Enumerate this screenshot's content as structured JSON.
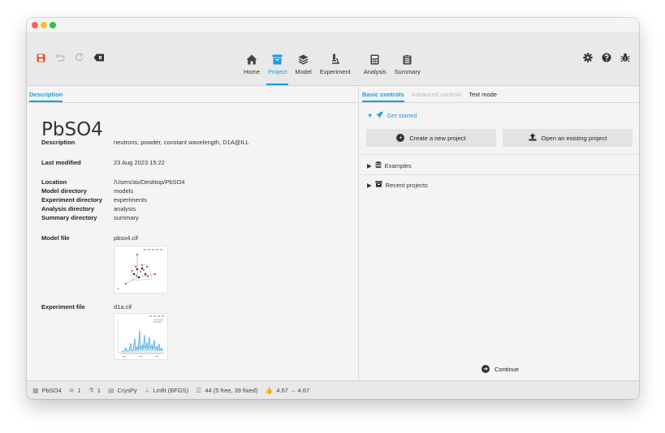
{
  "toolbar": {
    "tabs": [
      {
        "label": "Home",
        "icon": "home-icon"
      },
      {
        "label": "Project",
        "icon": "archive-icon"
      },
      {
        "label": "Model",
        "icon": "layers-icon"
      },
      {
        "label": "Experiment",
        "icon": "microscope-icon"
      },
      {
        "label": "Analysis",
        "icon": "calculator-icon"
      },
      {
        "label": "Summary",
        "icon": "clipboard-icon"
      }
    ],
    "active_tab": "Project",
    "accent_color": "#1c9be0"
  },
  "left_pane": {
    "tab": "Description",
    "project_name": "PbSO4",
    "description_label": "Description",
    "description_value": "neutrons, powder, constant wavelength, D1A@ILL",
    "last_modified_label": "Last modified",
    "last_modified_value": "23 Aug 2023 15:22",
    "location_label": "Location",
    "location_value": "/Users/as/Desktop/PbSO4",
    "model_dir_label": "Model directory",
    "model_dir_value": "models",
    "experiment_dir_label": "Experiment directory",
    "experiment_dir_value": "experiments",
    "analysis_dir_label": "Analysis directory",
    "analysis_dir_value": "analysis",
    "summary_dir_label": "Summary directory",
    "summary_dir_value": "summary",
    "model_file_label": "Model file",
    "model_file_value": "pbso4.cif",
    "experiment_file_label": "Experiment file",
    "experiment_file_value": "d1a.cif"
  },
  "right_pane": {
    "tabs": {
      "basic": "Basic controls",
      "advanced": "Advanced controls",
      "text": "Text mode"
    },
    "get_started": "Get started",
    "create_project": "Create a new project",
    "open_project": "Open an existing project",
    "examples": "Examples",
    "recent_projects": "Recent projects",
    "continue": "Continue"
  },
  "statusbar": {
    "project": "PbSO4",
    "models": "1",
    "experiments": "1",
    "calculator": "CrysPy",
    "minimizer": "Lmfit (BFGS)",
    "parameters": "44 (5 free, 39 fixed)",
    "goodness_of_fit": "4.67 → 4.67"
  }
}
